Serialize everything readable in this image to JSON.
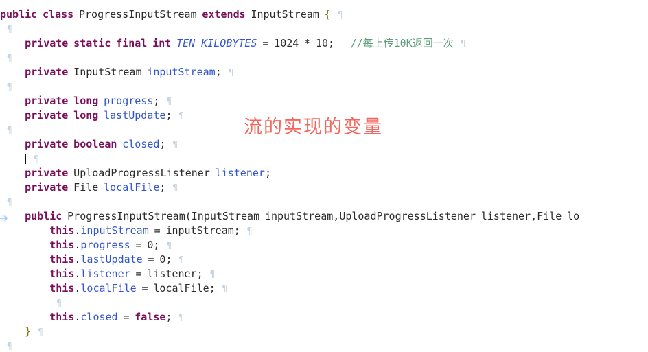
{
  "editor": {
    "language": "java",
    "background_color": "#ffffff",
    "show_whitespace_marks": true,
    "colors": {
      "keyword": "#7a0f5c",
      "field": "#3355cc",
      "constant": "#3355cc",
      "identifier": "#2b2b2b",
      "comment": "#5f9e7a",
      "brace": "#7a7a10",
      "whitespace_mark": "#cfd8e3",
      "annotation": "#f4655c",
      "caret": "#111111"
    }
  },
  "annotation": {
    "text": "流的实现的变量",
    "color": "#f4655c"
  },
  "gutter": {
    "marker_name": "change-marker-arrow"
  },
  "code": {
    "lines": [
      {
        "id": 1,
        "indent": 0,
        "tokens": [
          {
            "t": "kw",
            "v": "public"
          },
          {
            "t": "sp",
            "v": " "
          },
          {
            "t": "kw",
            "v": "class"
          },
          {
            "t": "sp",
            "v": " "
          },
          {
            "t": "type",
            "v": "ProgressInputStream"
          },
          {
            "t": "sp",
            "v": " "
          },
          {
            "t": "kw",
            "v": "extends"
          },
          {
            "t": "sp",
            "v": " "
          },
          {
            "t": "type",
            "v": "InputStream"
          },
          {
            "t": "sp",
            "v": " "
          },
          {
            "t": "brace",
            "v": "{"
          }
        ],
        "pilcrow": true
      },
      {
        "id": 2,
        "indent": 0,
        "tokens": [],
        "pilcrow": true
      },
      {
        "id": 3,
        "indent": 1,
        "tokens": [
          {
            "t": "kw",
            "v": "private"
          },
          {
            "t": "sp",
            "v": " "
          },
          {
            "t": "kw",
            "v": "static"
          },
          {
            "t": "sp",
            "v": " "
          },
          {
            "t": "kw",
            "v": "final"
          },
          {
            "t": "sp",
            "v": " "
          },
          {
            "t": "kw",
            "v": "int"
          },
          {
            "t": "sp",
            "v": " "
          },
          {
            "t": "constant",
            "v": "TEN_KILOBYTES"
          },
          {
            "t": "sp",
            "v": " "
          },
          {
            "t": "op",
            "v": "="
          },
          {
            "t": "sp",
            "v": " "
          },
          {
            "t": "num",
            "v": "1024"
          },
          {
            "t": "sp",
            "v": " "
          },
          {
            "t": "op",
            "v": "*"
          },
          {
            "t": "sp",
            "v": " "
          },
          {
            "t": "num",
            "v": "10"
          },
          {
            "t": "punc",
            "v": ";"
          },
          {
            "t": "sp",
            "v": "   "
          },
          {
            "t": "comment",
            "v": "//每上传10K返回一次"
          }
        ],
        "pilcrow": true
      },
      {
        "id": 4,
        "indent": 0,
        "tokens": [],
        "pilcrow": true
      },
      {
        "id": 5,
        "indent": 1,
        "tokens": [
          {
            "t": "kw",
            "v": "private"
          },
          {
            "t": "sp",
            "v": " "
          },
          {
            "t": "type",
            "v": "InputStream"
          },
          {
            "t": "sp",
            "v": " "
          },
          {
            "t": "field",
            "v": "inputStream"
          },
          {
            "t": "punc",
            "v": ";"
          }
        ],
        "pilcrow": true
      },
      {
        "id": 6,
        "indent": 0,
        "tokens": [],
        "pilcrow": true
      },
      {
        "id": 7,
        "indent": 1,
        "tokens": [
          {
            "t": "kw",
            "v": "private"
          },
          {
            "t": "sp",
            "v": " "
          },
          {
            "t": "kw",
            "v": "long"
          },
          {
            "t": "sp",
            "v": " "
          },
          {
            "t": "field",
            "v": "progress"
          },
          {
            "t": "punc",
            "v": ";"
          }
        ],
        "pilcrow": true
      },
      {
        "id": 8,
        "indent": 1,
        "tokens": [
          {
            "t": "kw",
            "v": "private"
          },
          {
            "t": "sp",
            "v": " "
          },
          {
            "t": "kw",
            "v": "long"
          },
          {
            "t": "sp",
            "v": " "
          },
          {
            "t": "field",
            "v": "lastUpdate"
          },
          {
            "t": "punc",
            "v": ";"
          }
        ],
        "pilcrow": true
      },
      {
        "id": 9,
        "indent": 0,
        "tokens": [],
        "pilcrow": true
      },
      {
        "id": 10,
        "indent": 1,
        "tokens": [
          {
            "t": "kw",
            "v": "private"
          },
          {
            "t": "sp",
            "v": " "
          },
          {
            "t": "kw",
            "v": "boolean"
          },
          {
            "t": "sp",
            "v": " "
          },
          {
            "t": "field",
            "v": "closed"
          },
          {
            "t": "punc",
            "v": ";"
          }
        ],
        "pilcrow": true
      },
      {
        "id": 11,
        "indent": 1,
        "tokens": [],
        "pilcrow": true,
        "caret": true
      },
      {
        "id": 12,
        "indent": 1,
        "tokens": [
          {
            "t": "kw",
            "v": "private"
          },
          {
            "t": "sp",
            "v": " "
          },
          {
            "t": "type",
            "v": "UploadProgressListener"
          },
          {
            "t": "sp",
            "v": " "
          },
          {
            "t": "field",
            "v": "listener"
          },
          {
            "t": "punc",
            "v": ";"
          }
        ],
        "pilcrow": false
      },
      {
        "id": 13,
        "indent": 1,
        "tokens": [
          {
            "t": "kw",
            "v": "private"
          },
          {
            "t": "sp",
            "v": " "
          },
          {
            "t": "type",
            "v": "File"
          },
          {
            "t": "sp",
            "v": " "
          },
          {
            "t": "field",
            "v": "localFile"
          },
          {
            "t": "punc",
            "v": ";"
          }
        ],
        "pilcrow": true
      },
      {
        "id": 14,
        "indent": 0,
        "tokens": [],
        "pilcrow": true
      },
      {
        "id": 15,
        "indent": 1,
        "tokens": [
          {
            "t": "kw",
            "v": "public"
          },
          {
            "t": "sp",
            "v": " "
          },
          {
            "t": "type",
            "v": "ProgressInputStream"
          },
          {
            "t": "punc",
            "v": "("
          },
          {
            "t": "type",
            "v": "InputStream"
          },
          {
            "t": "sp",
            "v": " "
          },
          {
            "t": "ident",
            "v": "inputStream"
          },
          {
            "t": "punc",
            "v": ","
          },
          {
            "t": "type",
            "v": "UploadProgressListener"
          },
          {
            "t": "sp",
            "v": " "
          },
          {
            "t": "ident",
            "v": "listener"
          },
          {
            "t": "punc",
            "v": ","
          },
          {
            "t": "type",
            "v": "File"
          },
          {
            "t": "sp",
            "v": " "
          },
          {
            "t": "ident",
            "v": "lo"
          }
        ],
        "pilcrow": false,
        "truncated": true
      },
      {
        "id": 16,
        "indent": 2,
        "tokens": [
          {
            "t": "kw",
            "v": "this"
          },
          {
            "t": "punc",
            "v": "."
          },
          {
            "t": "field",
            "v": "inputStream"
          },
          {
            "t": "sp",
            "v": " "
          },
          {
            "t": "op",
            "v": "="
          },
          {
            "t": "sp",
            "v": " "
          },
          {
            "t": "ident",
            "v": "inputStream"
          },
          {
            "t": "punc",
            "v": ";"
          }
        ],
        "pilcrow": true
      },
      {
        "id": 17,
        "indent": 2,
        "tokens": [
          {
            "t": "kw",
            "v": "this"
          },
          {
            "t": "punc",
            "v": "."
          },
          {
            "t": "field",
            "v": "progress"
          },
          {
            "t": "sp",
            "v": " "
          },
          {
            "t": "op",
            "v": "="
          },
          {
            "t": "sp",
            "v": " "
          },
          {
            "t": "num",
            "v": "0"
          },
          {
            "t": "punc",
            "v": ";"
          }
        ],
        "pilcrow": true
      },
      {
        "id": 18,
        "indent": 2,
        "tokens": [
          {
            "t": "kw",
            "v": "this"
          },
          {
            "t": "punc",
            "v": "."
          },
          {
            "t": "field",
            "v": "lastUpdate"
          },
          {
            "t": "sp",
            "v": " "
          },
          {
            "t": "op",
            "v": "="
          },
          {
            "t": "sp",
            "v": " "
          },
          {
            "t": "num",
            "v": "0"
          },
          {
            "t": "punc",
            "v": ";"
          }
        ],
        "pilcrow": true
      },
      {
        "id": 19,
        "indent": 2,
        "tokens": [
          {
            "t": "kw",
            "v": "this"
          },
          {
            "t": "punc",
            "v": "."
          },
          {
            "t": "field",
            "v": "listener"
          },
          {
            "t": "sp",
            "v": " "
          },
          {
            "t": "op",
            "v": "="
          },
          {
            "t": "sp",
            "v": " "
          },
          {
            "t": "ident",
            "v": "listener"
          },
          {
            "t": "punc",
            "v": ";"
          }
        ],
        "pilcrow": true
      },
      {
        "id": 20,
        "indent": 2,
        "tokens": [
          {
            "t": "kw",
            "v": "this"
          },
          {
            "t": "punc",
            "v": "."
          },
          {
            "t": "field",
            "v": "localFile"
          },
          {
            "t": "sp",
            "v": " "
          },
          {
            "t": "op",
            "v": "="
          },
          {
            "t": "sp",
            "v": " "
          },
          {
            "t": "ident",
            "v": "localFile"
          },
          {
            "t": "punc",
            "v": ";"
          }
        ],
        "pilcrow": true
      },
      {
        "id": 21,
        "indent": 2,
        "tokens": [],
        "pilcrow": true
      },
      {
        "id": 22,
        "indent": 2,
        "tokens": [
          {
            "t": "kw",
            "v": "this"
          },
          {
            "t": "punc",
            "v": "."
          },
          {
            "t": "field",
            "v": "closed"
          },
          {
            "t": "sp",
            "v": " "
          },
          {
            "t": "op",
            "v": "="
          },
          {
            "t": "sp",
            "v": " "
          },
          {
            "t": "kw",
            "v": "false"
          },
          {
            "t": "punc",
            "v": ";"
          }
        ],
        "pilcrow": true
      },
      {
        "id": 23,
        "indent": 1,
        "tokens": [
          {
            "t": "brace",
            "v": "}"
          }
        ],
        "pilcrow": true
      },
      {
        "id": 24,
        "indent": 0,
        "tokens": [],
        "pilcrow": true
      }
    ]
  }
}
